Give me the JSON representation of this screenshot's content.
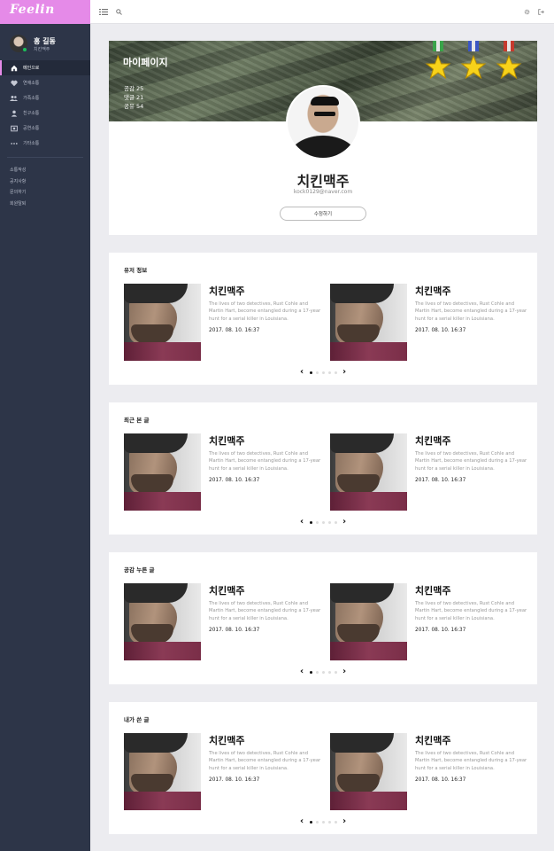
{
  "app": {
    "logo": "Feelin"
  },
  "user": {
    "name": "홍 길동",
    "nickname": "치킨맥주"
  },
  "nav": {
    "items": [
      {
        "label": "메인으로",
        "icon": "home-icon",
        "active": true
      },
      {
        "label": "연애소통",
        "icon": "heart-icon",
        "active": false
      },
      {
        "label": "가족소통",
        "icon": "group-icon",
        "active": false
      },
      {
        "label": "친구소통",
        "icon": "person-icon",
        "active": false
      },
      {
        "label": "공연소통",
        "icon": "ticket-icon",
        "active": false
      },
      {
        "label": "기타소통",
        "icon": "more-icon",
        "active": false
      }
    ],
    "links": [
      "소통작성",
      "공지사항",
      "문의하기",
      "회원탈퇴"
    ]
  },
  "topbar": {
    "icons": [
      "menu-icon",
      "search-icon",
      "gear-icon",
      "logout-icon"
    ]
  },
  "profile": {
    "banner_title": "마이페이지",
    "stats": [
      {
        "label": "공감",
        "value": "25"
      },
      {
        "label": "댓글",
        "value": "21"
      },
      {
        "label": "공유",
        "value": "54"
      }
    ],
    "medals": 3,
    "name": "치킨맥주",
    "email": "kock0129@naver.com",
    "edit_label": "수정하기"
  },
  "sections": [
    {
      "title": "유저 정보"
    },
    {
      "title": "최근 본 글"
    },
    {
      "title": "공감 누른 글"
    },
    {
      "title": "내가 쓴 글"
    }
  ],
  "post": {
    "title": "치킨맥주",
    "description": "The lives of two detectives, Rust Cohle and Martin Hart, become entangled during a 17-year hunt for a serial killer in Louisiana.",
    "date": "2017. 08. 10. 16:37"
  },
  "pager": {
    "prev": "‹",
    "next": "›",
    "pages": 5,
    "current": 1
  },
  "colors": {
    "accent": "#e58ae8",
    "sidebar": "#2d3548",
    "online": "#1bbf5a"
  }
}
